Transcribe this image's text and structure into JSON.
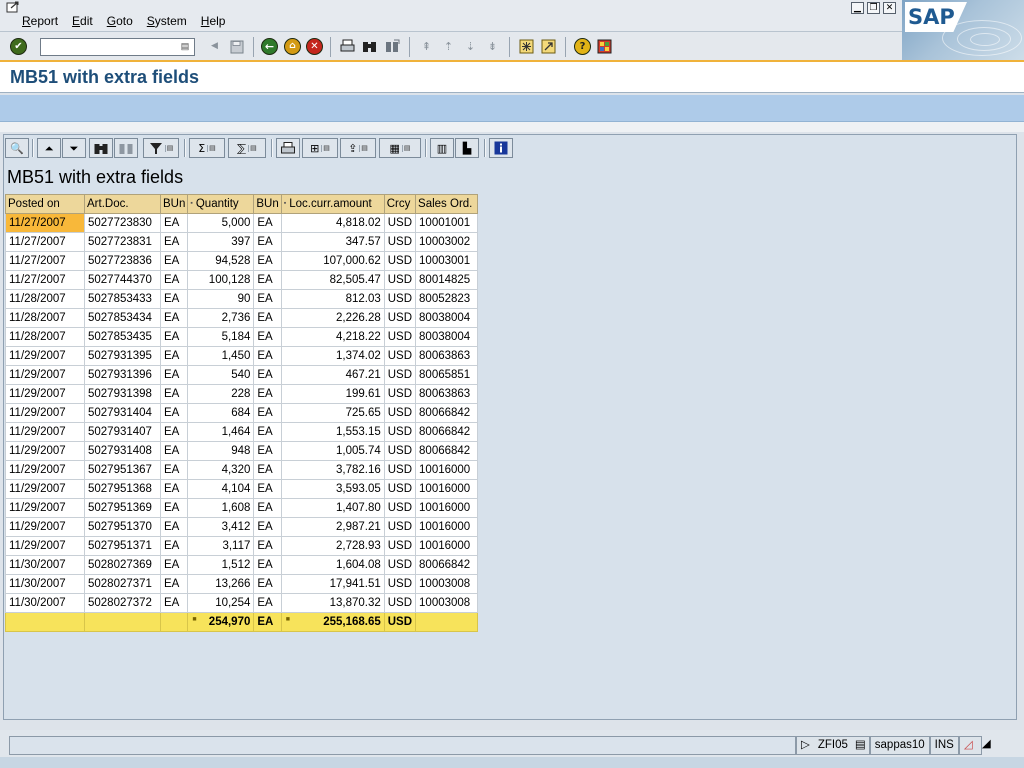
{
  "menu": {
    "items": [
      {
        "label": "Report",
        "u": "R"
      },
      {
        "label": "Edit",
        "u": "E"
      },
      {
        "label": "Goto",
        "u": "G"
      },
      {
        "label": "System",
        "u": "S"
      },
      {
        "label": "Help",
        "u": "H"
      }
    ]
  },
  "window_controls": [
    "minimize-icon",
    "restore-icon",
    "close-icon"
  ],
  "logo_text": "SAP",
  "command_field": {
    "value": ""
  },
  "title": "MB51 with extra fields",
  "alv": {
    "title": "MB51 with extra fields",
    "columns": [
      {
        "label": "Posted on",
        "sum": false
      },
      {
        "label": "Art.Doc.",
        "sum": false
      },
      {
        "label": "BUn",
        "sum": false
      },
      {
        "label": "Quantity",
        "sum": true
      },
      {
        "label": "BUn",
        "sum": false
      },
      {
        "label": "Loc.curr.amount",
        "sum": true
      },
      {
        "label": "Crcy",
        "sum": false
      },
      {
        "label": "Sales Ord.",
        "sum": false
      }
    ],
    "rows": [
      [
        "11/27/2007",
        "5027723830",
        "EA",
        "5,000",
        "EA",
        "4,818.02",
        "USD",
        "10001001"
      ],
      [
        "11/27/2007",
        "5027723831",
        "EA",
        "397",
        "EA",
        "347.57",
        "USD",
        "10003002"
      ],
      [
        "11/27/2007",
        "5027723836",
        "EA",
        "94,528",
        "EA",
        "107,000.62",
        "USD",
        "10003001"
      ],
      [
        "11/27/2007",
        "5027744370",
        "EA",
        "100,128",
        "EA",
        "82,505.47",
        "USD",
        "80014825"
      ],
      [
        "11/28/2007",
        "5027853433",
        "EA",
        "90",
        "EA",
        "812.03",
        "USD",
        "80052823"
      ],
      [
        "11/28/2007",
        "5027853434",
        "EA",
        "2,736",
        "EA",
        "2,226.28",
        "USD",
        "80038004"
      ],
      [
        "11/28/2007",
        "5027853435",
        "EA",
        "5,184",
        "EA",
        "4,218.22",
        "USD",
        "80038004"
      ],
      [
        "11/29/2007",
        "5027931395",
        "EA",
        "1,450",
        "EA",
        "1,374.02",
        "USD",
        "80063863"
      ],
      [
        "11/29/2007",
        "5027931396",
        "EA",
        "540",
        "EA",
        "467.21",
        "USD",
        "80065851"
      ],
      [
        "11/29/2007",
        "5027931398",
        "EA",
        "228",
        "EA",
        "199.61",
        "USD",
        "80063863"
      ],
      [
        "11/29/2007",
        "5027931404",
        "EA",
        "684",
        "EA",
        "725.65",
        "USD",
        "80066842"
      ],
      [
        "11/29/2007",
        "5027931407",
        "EA",
        "1,464",
        "EA",
        "1,553.15",
        "USD",
        "80066842"
      ],
      [
        "11/29/2007",
        "5027931408",
        "EA",
        "948",
        "EA",
        "1,005.74",
        "USD",
        "80066842"
      ],
      [
        "11/29/2007",
        "5027951367",
        "EA",
        "4,320",
        "EA",
        "3,782.16",
        "USD",
        "10016000"
      ],
      [
        "11/29/2007",
        "5027951368",
        "EA",
        "4,104",
        "EA",
        "3,593.05",
        "USD",
        "10016000"
      ],
      [
        "11/29/2007",
        "5027951369",
        "EA",
        "1,608",
        "EA",
        "1,407.80",
        "USD",
        "10016000"
      ],
      [
        "11/29/2007",
        "5027951370",
        "EA",
        "3,412",
        "EA",
        "2,987.21",
        "USD",
        "10016000"
      ],
      [
        "11/29/2007",
        "5027951371",
        "EA",
        "3,117",
        "EA",
        "2,728.93",
        "USD",
        "10016000"
      ],
      [
        "11/30/2007",
        "5028027369",
        "EA",
        "1,512",
        "EA",
        "1,604.08",
        "USD",
        "80066842"
      ],
      [
        "11/30/2007",
        "5028027371",
        "EA",
        "13,266",
        "EA",
        "17,941.51",
        "USD",
        "10003008"
      ],
      [
        "11/30/2007",
        "5028027372",
        "EA",
        "10,254",
        "EA",
        "13,870.32",
        "USD",
        "10003008"
      ]
    ],
    "total": {
      "quantity": "254,970",
      "quantity_unit": "EA",
      "amount": "255,168.65",
      "currency": "USD"
    }
  },
  "status": {
    "message": "",
    "transaction": "ZFI05",
    "server": "sappas10",
    "mode": "INS"
  },
  "colors": {
    "header_bg": "#edd79b",
    "total_row_bg": "#f7e35b",
    "selected_cell_bg": "#f8b83a",
    "title_color": "#1e4e79",
    "app_toolbar": "#aecbe9"
  }
}
